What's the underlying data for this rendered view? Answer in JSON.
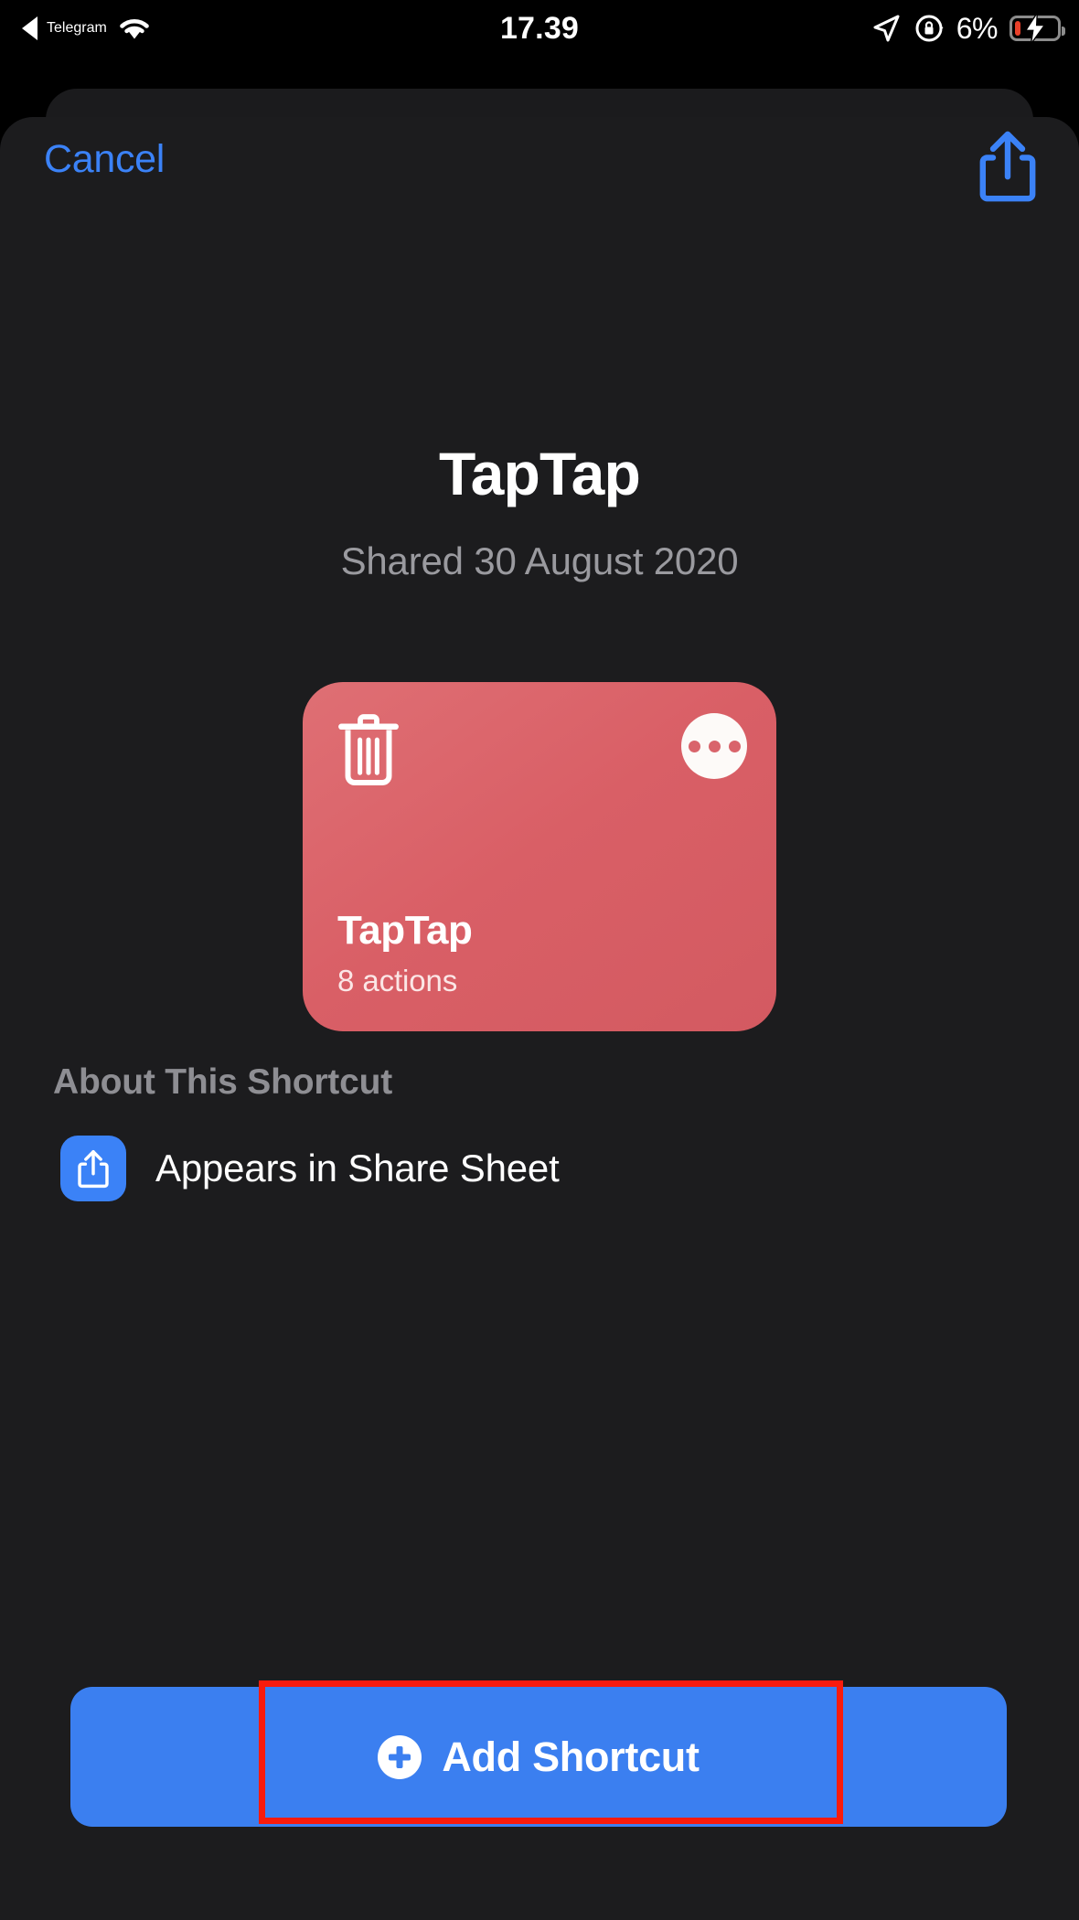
{
  "status_bar": {
    "back_indicator_icon": "back-triangle-icon",
    "back_app_label": "Telegram",
    "wifi_icon": "wifi-icon",
    "time": "17.39",
    "location_icon": "location-arrow-icon",
    "rotation_lock_icon": "rotation-lock-icon",
    "battery_percent": "6%",
    "battery_icon": "battery-charging-icon",
    "battery_low_color": "#e8402a"
  },
  "nav": {
    "cancel_label": "Cancel",
    "cancel_color": "#3b82f7",
    "share_icon": "share-icon"
  },
  "hero": {
    "title": "TapTap",
    "shared_date": "Shared 30 August 2020"
  },
  "card": {
    "name": "TapTap",
    "actions_count": "8 actions",
    "glyph_icon": "trash-icon",
    "more_icon": "ellipsis-icon",
    "background_color": "#d9636a"
  },
  "about": {
    "heading": "About This Shortcut",
    "rows": [
      {
        "icon": "share-sheet-icon",
        "icon_color": "#3b82f7",
        "label": "Appears in Share Sheet"
      }
    ]
  },
  "primary_action": {
    "label": "Add Shortcut",
    "icon": "plus-circle-icon",
    "background_color": "#3b7ff0"
  },
  "annotation": {
    "type": "rectangle-highlight",
    "color": "#f81b0d",
    "targets": "add-shortcut-button"
  }
}
